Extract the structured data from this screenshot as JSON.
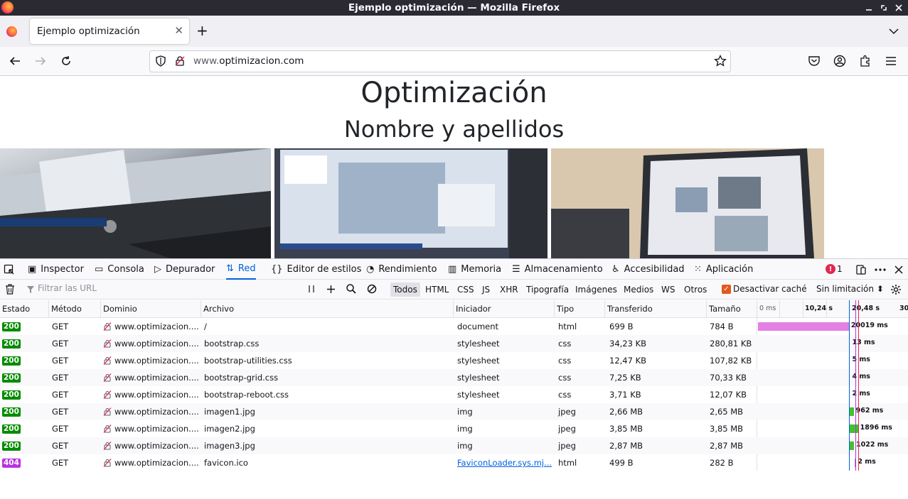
{
  "window": {
    "title": "Ejemplo optimización — Mozilla Firefox"
  },
  "tab": {
    "title": "Ejemplo optimización"
  },
  "urlbar": {
    "prefix": "www.",
    "domain": "optimizacion.com"
  },
  "page": {
    "heading": "Optimización",
    "subheading": "Nombre y apellidos"
  },
  "devtools": {
    "tabs": [
      "Inspector",
      "Consola",
      "Depurador",
      "Red",
      "Editor de estilos",
      "Rendimiento",
      "Memoria",
      "Almacenamiento",
      "Accesibilidad",
      "Aplicación"
    ],
    "active_tab": "Red",
    "error_count": "1"
  },
  "filter": {
    "placeholder": "Filtrar las URL",
    "types": [
      "Todos",
      "HTML",
      "CSS",
      "JS",
      "XHR",
      "Tipografía",
      "Imágenes",
      "Medios",
      "WS",
      "Otros"
    ],
    "active_type": "Todos",
    "disable_cache": "Desactivar caché",
    "throttling": "Sin limitación"
  },
  "columns": [
    "Estado",
    "Método",
    "Dominio",
    "Archivo",
    "Iniciador",
    "Tipo",
    "Transferido",
    "Tamaño"
  ],
  "timeline_ticks": [
    "0 ms",
    "10,24 s",
    "20,48 s",
    "30"
  ],
  "requests": [
    {
      "status": "200",
      "method": "GET",
      "domain": "www.optimizacion....",
      "file": "/",
      "initiator": "document",
      "type": "html",
      "transferred": "699 B",
      "size": "784 B",
      "time": "20019 ms"
    },
    {
      "status": "200",
      "method": "GET",
      "domain": "www.optimizacion....",
      "file": "bootstrap.css",
      "initiator": "stylesheet",
      "type": "css",
      "transferred": "34,23 KB",
      "size": "280,81 KB",
      "time": "13 ms"
    },
    {
      "status": "200",
      "method": "GET",
      "domain": "www.optimizacion....",
      "file": "bootstrap-utilities.css",
      "initiator": "stylesheet",
      "type": "css",
      "transferred": "12,47 KB",
      "size": "107,82 KB",
      "time": "5 ms"
    },
    {
      "status": "200",
      "method": "GET",
      "domain": "www.optimizacion....",
      "file": "bootstrap-grid.css",
      "initiator": "stylesheet",
      "type": "css",
      "transferred": "7,25 KB",
      "size": "70,33 KB",
      "time": "4 ms"
    },
    {
      "status": "200",
      "method": "GET",
      "domain": "www.optimizacion....",
      "file": "bootstrap-reboot.css",
      "initiator": "stylesheet",
      "type": "css",
      "transferred": "3,71 KB",
      "size": "12,07 KB",
      "time": "2 ms"
    },
    {
      "status": "200",
      "method": "GET",
      "domain": "www.optimizacion....",
      "file": "imagen1.jpg",
      "initiator": "img",
      "type": "jpeg",
      "transferred": "2,66 MB",
      "size": "2,65 MB",
      "time": "962 ms"
    },
    {
      "status": "200",
      "method": "GET",
      "domain": "www.optimizacion....",
      "file": "imagen2.jpg",
      "initiator": "img",
      "type": "jpeg",
      "transferred": "3,85 MB",
      "size": "3,85 MB",
      "time": "1896 ms"
    },
    {
      "status": "200",
      "method": "GET",
      "domain": "www.optimizacion....",
      "file": "imagen3.jpg",
      "initiator": "img",
      "type": "jpeg",
      "transferred": "2,87 MB",
      "size": "2,87 MB",
      "time": "1022 ms"
    },
    {
      "status": "404",
      "method": "GET",
      "domain": "www.optimizacion....",
      "file": "favicon.ico",
      "initiator": "FaviconLoader.sys.mj...",
      "type": "html",
      "transferred": "499 B",
      "size": "282 B",
      "time": "2 ms"
    }
  ],
  "colors": {
    "accent": "#0061e0",
    "status_ok": "#058b00",
    "status_404": "#b833e1",
    "doc_bar": "#e47fe3",
    "img_bar": "#3fc32a",
    "css_bar": "#5aa3de"
  }
}
